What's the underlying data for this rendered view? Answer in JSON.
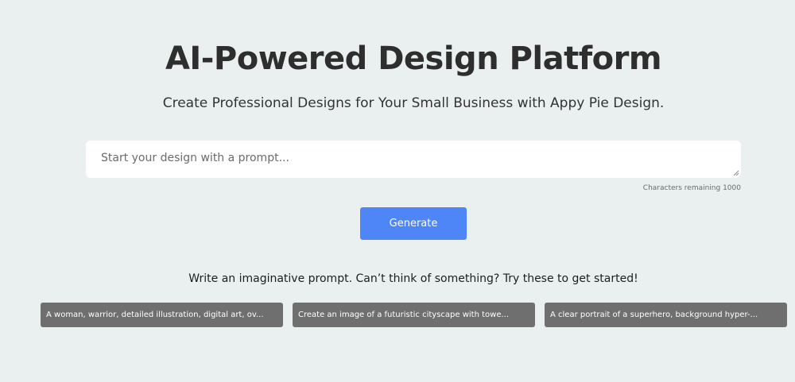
{
  "hero": {
    "title": "AI-Powered Design Platform",
    "subtitle": "Create Professional Designs for Your Small Business with Appy Pie Design."
  },
  "prompt": {
    "placeholder": "Start your design with a prompt...",
    "value": "",
    "characters_remaining": "Characters remaining 1000"
  },
  "generate_label": "Generate",
  "hint": "Write an imaginative prompt. Can’t think of something? Try these to get started!",
  "suggestions": [
    "A woman, warrior, detailed illustration, digital art, ov...",
    "Create an image of a futuristic cityscape with towe...",
    "A clear portrait of a superhero, background hyper-..."
  ],
  "colors": {
    "background": "#e9f0ef",
    "accent": "#4f86f7",
    "chip": "#6f6f6f"
  }
}
